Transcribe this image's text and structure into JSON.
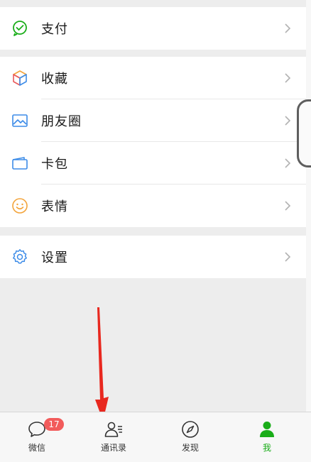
{
  "menu": {
    "payment": {
      "label": "支付",
      "icon": "wechat-pay-icon"
    },
    "favorites": {
      "label": "收藏",
      "icon": "cube-icon"
    },
    "moments": {
      "label": "朋友圈",
      "icon": "image-icon"
    },
    "cards": {
      "label": "卡包",
      "icon": "card-wallet-icon"
    },
    "stickers": {
      "label": "表情",
      "icon": "smiley-icon"
    },
    "settings": {
      "label": "设置",
      "icon": "gear-icon"
    }
  },
  "tabbar": {
    "chats": {
      "label": "微信",
      "badge": "17",
      "icon": "chat-bubble-icon"
    },
    "contacts": {
      "label": "通讯录",
      "icon": "contacts-icon"
    },
    "discover": {
      "label": "发现",
      "icon": "compass-icon"
    },
    "me": {
      "label": "我",
      "icon": "person-icon",
      "active_color": "#1aad19"
    }
  },
  "colors": {
    "accent": "#1aad19",
    "badge": "#f25b5b",
    "annotation_arrow": "#e8281f"
  }
}
